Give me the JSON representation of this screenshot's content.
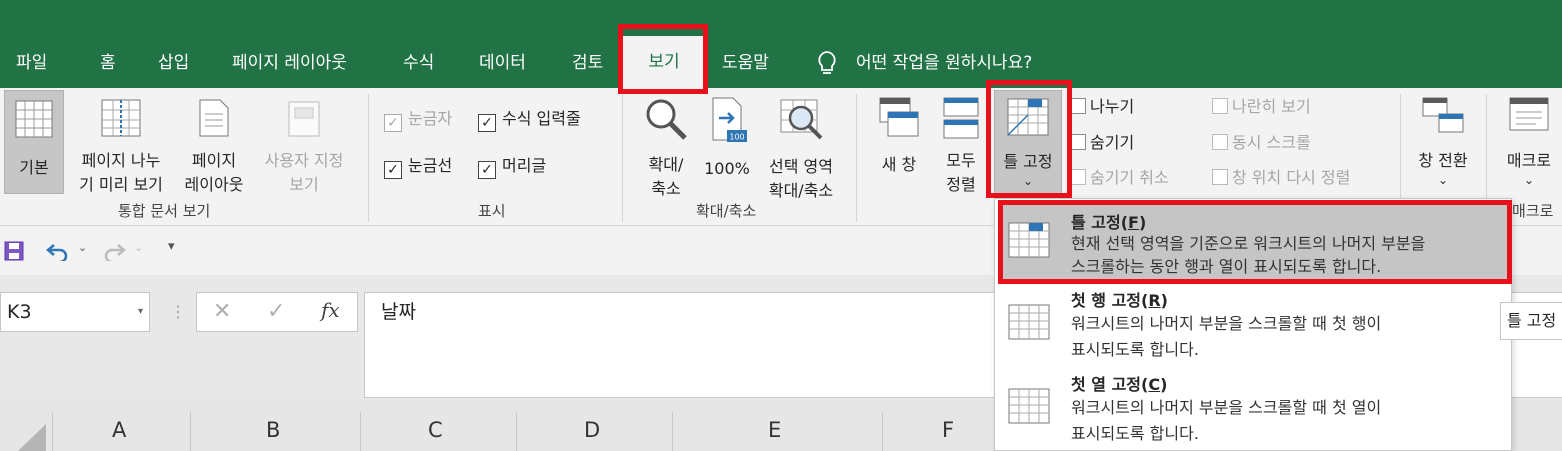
{
  "tabs": [
    "파일",
    "홈",
    "삽입",
    "페이지 레이아웃",
    "수식",
    "데이터",
    "검토",
    "보기",
    "도움말"
  ],
  "tell_me": "어떤 작업을 원하시나요?",
  "ribbon": {
    "views": {
      "normal": "기본",
      "page_break_1": "페이지 나누",
      "page_break_2": "기 미리 보기",
      "page_layout_1": "페이지",
      "page_layout_2": "레이아웃",
      "custom_1": "사용자 지정",
      "custom_2": "보기",
      "group": "통합 문서 보기"
    },
    "show": {
      "ruler": "눈금자",
      "formula_bar": "수식 입력줄",
      "gridlines": "눈금선",
      "headings": "머리글",
      "group": "표시"
    },
    "zoom": {
      "zoom_1": "확대/",
      "zoom_2": "축소",
      "hundred": "100%",
      "zoom_sel_1": "선택 영역",
      "zoom_sel_2": "확대/축소",
      "group": "확대/축소"
    },
    "window": {
      "new_window": "새 창",
      "arrange_1": "모두",
      "arrange_2": "정렬",
      "freeze": "틀 고정",
      "split": "나누기",
      "hide": "숨기기",
      "unhide": "숨기기 취소",
      "side_by_side": "나란히 보기",
      "sync_scroll": "동시 스크롤",
      "reset_pos": "창 위치 다시 정렬",
      "switch": "창 전환"
    },
    "macros": {
      "macro": "매크로",
      "group_partial": "매크로"
    }
  },
  "name_box": "K3",
  "formula": "날짜",
  "columns": [
    "A",
    "B",
    "C",
    "D",
    "E",
    "F"
  ],
  "menu": {
    "items": [
      {
        "title": "틀 고정",
        "key": "F",
        "desc1": "현재 선택 영역을 기준으로 워크시트의 나머지 부분을",
        "desc2": "스크롤하는 동안 행과 열이 표시되도록 합니다."
      },
      {
        "title": "첫 행 고정",
        "key": "R",
        "desc1": "워크시트의 나머지 부분을 스크롤할 때 첫 행이",
        "desc2": "표시되도록 합니다."
      },
      {
        "title": "첫 열 고정",
        "key": "C",
        "desc1": "워크시트의 나머지 부분을 스크롤할 때 첫 열이",
        "desc2": "표시되도록 합니다."
      }
    ]
  },
  "tooltip": "틀 고정",
  "colors": {
    "excel_green": "#217346",
    "highlight": "#e8111b",
    "icon_blue": "#2e75b6"
  }
}
